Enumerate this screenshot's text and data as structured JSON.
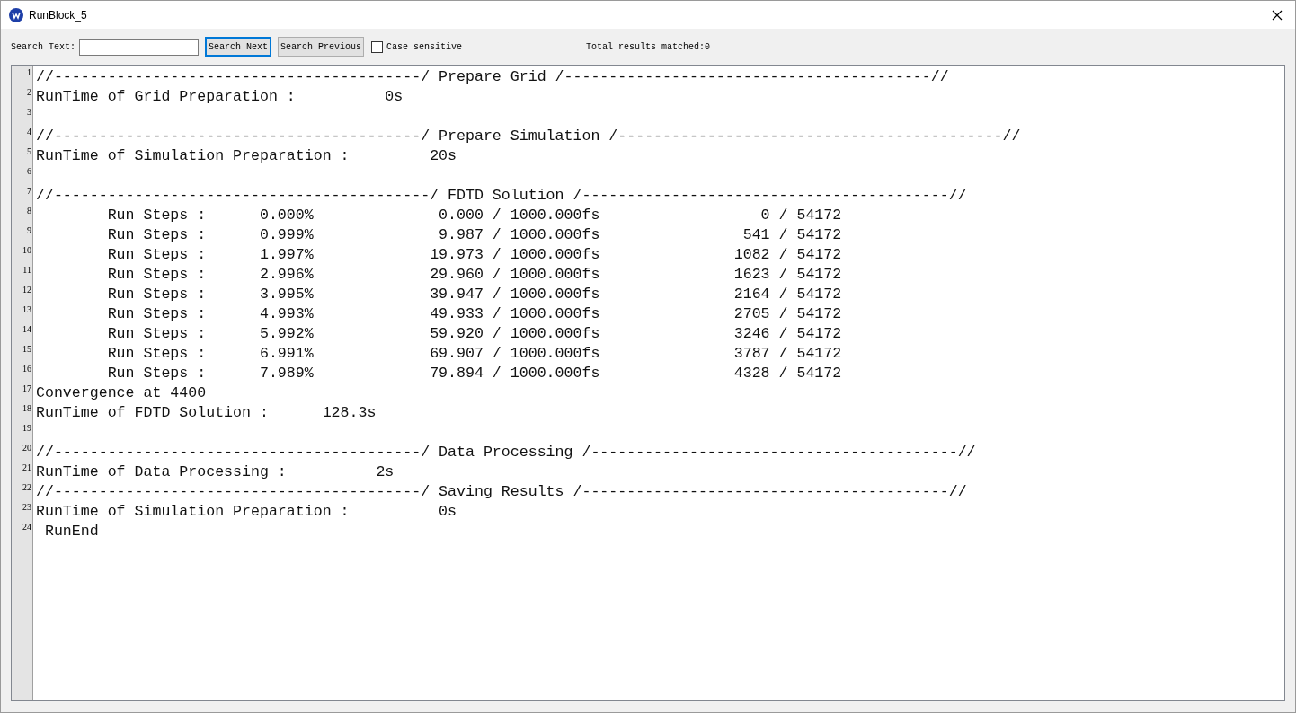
{
  "window": {
    "title": "RunBlock_5"
  },
  "toolbar": {
    "search_label": "Search Text:",
    "buttons": [
      {
        "label": "Search Next",
        "focused": true
      },
      {
        "label": "Search Previous",
        "focused": false
      }
    ],
    "case_sensitive": {
      "label": "Case sensitive",
      "checked": false
    },
    "results": "Total results matched:0"
  },
  "log_lines": [
    {
      "number": "1",
      "text": "//-----------------------------------------/ Prepare Grid /-----------------------------------------//"
    },
    {
      "number": "2",
      "text": "RunTime of Grid Preparation :          0s"
    },
    {
      "number": "3"
    },
    {
      "number": "4",
      "text": "//-----------------------------------------/ Prepare Simulation /-------------------------------------------//"
    },
    {
      "number": "5",
      "text": "RunTime of Simulation Preparation :         20s"
    },
    {
      "number": "6"
    },
    {
      "number": "7",
      "text": "//------------------------------------------/ FDTD Solution /-----------------------------------------//"
    },
    {
      "number": "8",
      "text": "        Run Steps :      0.000%              0.000 / 1000.000fs                  0 / 54172"
    },
    {
      "number": "9",
      "text": "        Run Steps :      0.999%              9.987 / 1000.000fs                541 / 54172"
    },
    {
      "number": "10",
      "text": "        Run Steps :      1.997%             19.973 / 1000.000fs               1082 / 54172"
    },
    {
      "number": "11",
      "text": "        Run Steps :      2.996%             29.960 / 1000.000fs               1623 / 54172"
    },
    {
      "number": "12",
      "text": "        Run Steps :      3.995%             39.947 / 1000.000fs               2164 / 54172"
    },
    {
      "number": "13",
      "text": "        Run Steps :      4.993%             49.933 / 1000.000fs               2705 / 54172"
    },
    {
      "number": "14",
      "text": "        Run Steps :      5.992%             59.920 / 1000.000fs               3246 / 54172"
    },
    {
      "number": "15",
      "text": "        Run Steps :      6.991%             69.907 / 1000.000fs               3787 / 54172"
    },
    {
      "number": "16",
      "text": "        Run Steps :      7.989%             79.894 / 1000.000fs               4328 / 54172"
    },
    {
      "number": "17",
      "text": "Convergence at 4400"
    },
    {
      "number": "18",
      "text": "RunTime of FDTD Solution :      128.3s"
    },
    {
      "number": "19"
    },
    {
      "number": "20",
      "text": "//-----------------------------------------/ Data Processing /-----------------------------------------//"
    },
    {
      "number": "21",
      "text": "RunTime of Data Processing :          2s"
    },
    {
      "number": "22",
      "text": "//-----------------------------------------/ Saving Results /-----------------------------------------//"
    },
    {
      "number": "23",
      "text": "RunTime of Simulation Preparation :          0s"
    },
    {
      "number": "24",
      "text": " RunEnd"
    }
  ]
}
